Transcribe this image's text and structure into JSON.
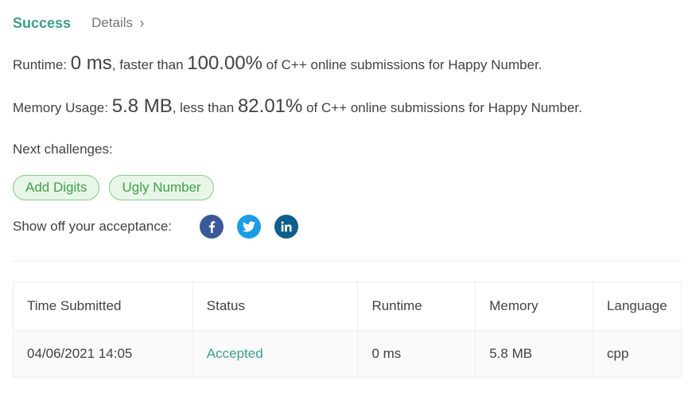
{
  "result": {
    "status": "Success",
    "details_label": "Details",
    "details_chevron": "›"
  },
  "runtime": {
    "label": "Runtime: ",
    "value": "0 ms",
    "comparison": ", faster than ",
    "percent": "100.00%",
    "suffix": " of C++ online submissions for Happy Number."
  },
  "memory": {
    "label": "Memory Usage: ",
    "value": "5.8 MB",
    "comparison": ", less than ",
    "percent": "82.01%",
    "suffix": " of C++ online submissions for Happy Number."
  },
  "next_challenges": {
    "label": "Next challenges:",
    "items": [
      "Add Digits",
      "Ugly Number"
    ]
  },
  "share": {
    "label": "Show off your acceptance:",
    "icons": [
      "facebook-icon",
      "twitter-icon",
      "linkedin-icon"
    ]
  },
  "submissions": {
    "columns": [
      "Time Submitted",
      "Status",
      "Runtime",
      "Memory",
      "Language"
    ],
    "rows": [
      {
        "time": "04/06/2021 14:05",
        "status": "Accepted",
        "runtime": "0 ms",
        "memory": "5.8 MB",
        "language": "cpp"
      }
    ]
  },
  "colors": {
    "success": "#3c9f8f",
    "pill_border": "#88c98a",
    "pill_bg": "#e8f5e9",
    "pill_text": "#43a047",
    "facebook": "#3b5998",
    "twitter": "#1d9ce6",
    "linkedin": "#0e5f8a"
  }
}
